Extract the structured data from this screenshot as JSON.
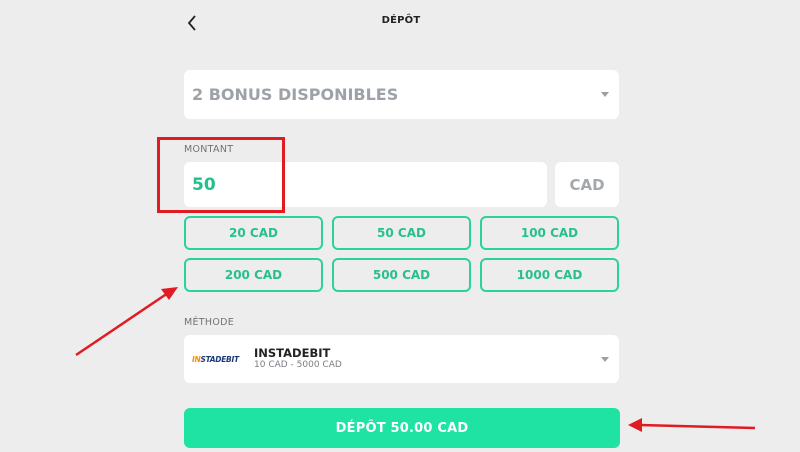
{
  "header": {
    "title": "DÉPÔT",
    "back_icon": "chevron-left-icon"
  },
  "bonus": {
    "label": "2 BONUS DISPONIBLES"
  },
  "amount": {
    "label": "MONTANT",
    "value": "50",
    "currency": "CAD"
  },
  "quick_amounts": [
    "20 CAD",
    "50 CAD",
    "100 CAD",
    "200 CAD",
    "500 CAD",
    "1000 CAD"
  ],
  "method": {
    "label": "MÉTHODE",
    "logo_prefix": "IN",
    "logo_rest": "STADEBIT",
    "name": "INSTADEBIT",
    "range": "10 CAD - 5000 CAD"
  },
  "submit": {
    "label": "DÉPÔT 50.00 CAD"
  },
  "annotation_colors": {
    "highlight": "#e01b22",
    "accent": "#1fe3a3"
  }
}
